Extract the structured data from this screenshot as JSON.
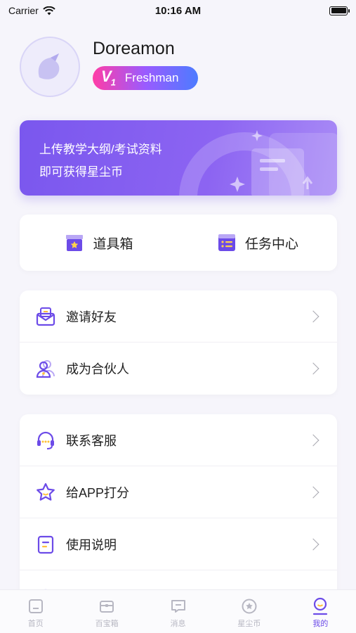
{
  "status_bar": {
    "carrier": "Carrier",
    "time": "10:16 AM"
  },
  "profile": {
    "username": "Doreamon",
    "level": "V",
    "level_sub": "1",
    "level_label": "Freshman"
  },
  "banner": {
    "line1": "上传教学大纲/考试资料",
    "line2": "即可获得星尘币"
  },
  "quick_actions": [
    {
      "label": "道具箱",
      "icon": "toolbox-icon"
    },
    {
      "label": "任务中心",
      "icon": "task-list-icon"
    }
  ],
  "menu_group1": [
    {
      "label": "邀请好友",
      "icon": "invite-mail-icon"
    },
    {
      "label": "成为合伙人",
      "icon": "partner-users-icon"
    }
  ],
  "menu_group2": [
    {
      "label": "联系客服",
      "icon": "headset-icon"
    },
    {
      "label": "给APP打分",
      "icon": "star-rate-icon"
    },
    {
      "label": "使用说明",
      "icon": "document-icon"
    }
  ],
  "tabbar": [
    {
      "label": "首页",
      "icon": "home-icon",
      "active": false
    },
    {
      "label": "百宝箱",
      "icon": "treasure-box-icon",
      "active": false
    },
    {
      "label": "消息",
      "icon": "message-icon",
      "active": false
    },
    {
      "label": "星尘币",
      "icon": "star-coin-icon",
      "active": false
    },
    {
      "label": "我的",
      "icon": "profile-icon",
      "active": true
    }
  ],
  "colors": {
    "accent": "#6c4be8",
    "banner_start": "#7a57ee",
    "banner_end": "#a98bf6",
    "inactive_tab": "#b7b7c2"
  }
}
